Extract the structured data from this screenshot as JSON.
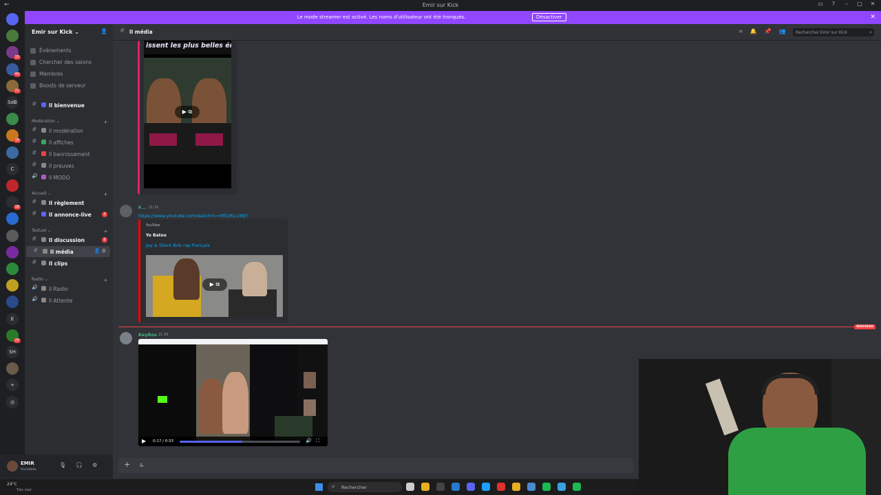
{
  "window": {
    "title": "Emir sur Kick"
  },
  "banner": {
    "message": "Le mode streamer est activé. Les noms d'utilisateur ont été tronqués.",
    "button": "Désactiver",
    "color": "#9146ff"
  },
  "servers": [
    {
      "label": "",
      "color": "#5865f2",
      "badge": ""
    },
    {
      "label": "",
      "color": "#4a7a3a",
      "badge": ""
    },
    {
      "label": "",
      "color": "#7a3a8a",
      "badge": "15"
    },
    {
      "label": "",
      "color": "#3a5aa0",
      "badge": "40"
    },
    {
      "label": "",
      "color": "#8a6a3a",
      "badge": "21"
    },
    {
      "label": "SdB",
      "color": "#2b2d31",
      "badge": ""
    },
    {
      "label": "",
      "color": "#3a8a4a",
      "badge": ""
    },
    {
      "label": "",
      "color": "#c8781e",
      "badge": "18"
    },
    {
      "label": "",
      "color": "#3a6aa0",
      "badge": ""
    },
    {
      "label": "C",
      "color": "#2b2d31",
      "badge": ""
    },
    {
      "label": "",
      "color": "#c0262b",
      "badge": ""
    },
    {
      "label": "",
      "color": "#2b2d31",
      "badge": "18"
    },
    {
      "label": "",
      "color": "#2a6ad0",
      "badge": ""
    },
    {
      "label": "",
      "color": "#5a5a5a",
      "badge": ""
    },
    {
      "label": "",
      "color": "#7a2aa0",
      "badge": ""
    },
    {
      "label": "",
      "color": "#2a8a3a",
      "badge": ""
    },
    {
      "label": "",
      "color": "#c0a020",
      "badge": ""
    },
    {
      "label": "",
      "color": "#2a4a8a",
      "badge": ""
    },
    {
      "label": "E",
      "color": "#2b2d31",
      "badge": ""
    },
    {
      "label": "",
      "color": "#2a7a2a",
      "badge": "29"
    },
    {
      "label": "SH",
      "color": "#2b2d31",
      "badge": ""
    },
    {
      "label": "",
      "color": "#6a5a4a",
      "badge": ""
    },
    {
      "label": "+",
      "color": "#2b2d31",
      "badge": ""
    },
    {
      "label": "◎",
      "color": "#2b2d31",
      "badge": ""
    }
  ],
  "guild": {
    "name": "Emir sur Kick"
  },
  "nav": [
    {
      "label": "Événements",
      "icon": "calendar-icon"
    },
    {
      "label": "Chercher des salons",
      "icon": "search-channels-icon"
    },
    {
      "label": "Membres",
      "icon": "members-icon"
    },
    {
      "label": "Boosts de serveur",
      "icon": "boost-icon"
    }
  ],
  "channels_top": [
    {
      "label": "ll bienvenue",
      "bold": true,
      "emoji_color": "#5865f2"
    }
  ],
  "categories": {
    "moderation": "Modération",
    "accueil": "Accueil",
    "textuel": "Textuel",
    "radio": "Radio"
  },
  "channels_mod": [
    {
      "label": "ll modération",
      "emoji_color": "#888"
    },
    {
      "label": "ll affiches",
      "emoji_color": "#3ba55d"
    },
    {
      "label": "ll bannissement",
      "emoji_color": "#ed4245"
    },
    {
      "label": "ll preuves",
      "emoji_color": "#888"
    },
    {
      "label": "ll MODO",
      "emoji_color": "#b05ac0"
    }
  ],
  "channels_accueil": [
    {
      "label": "ll règlement",
      "bold": true,
      "count": "",
      "emoji_color": "#888"
    },
    {
      "label": "ll annonce-live",
      "bold": true,
      "count": "3",
      "emoji_color": "#5865f2"
    }
  ],
  "channels_text": [
    {
      "label": "ll discussion",
      "bold": true,
      "count": "5",
      "emoji_color": "#888"
    },
    {
      "label": "ll média",
      "bold": true,
      "count": "",
      "emoji_color": "#888",
      "selected": true
    },
    {
      "label": "ll clips",
      "bold": true,
      "count": "",
      "emoji_color": "#888"
    }
  ],
  "channels_radio": [
    {
      "label": "ll Radio",
      "emoji_color": "#888"
    },
    {
      "label": "ll Attente",
      "emoji_color": "#888"
    }
  ],
  "user": {
    "name": "EMIR",
    "status": "Invisible"
  },
  "header": {
    "channel": "ll média",
    "search_placeholder": "Rechercher Emir sur Kick"
  },
  "embed1": {
    "caption": "issent les plus belles émotion"
  },
  "message1": {
    "author": "F...",
    "time": "21:31",
    "link": "https://www.youtube.com/watch?v=HfEzRLr2MJY",
    "provider": "YouTube",
    "embed_author": "Yo Batou",
    "embed_title": "Jay & Silent Bob rap français"
  },
  "new_marker": "NOUVEAU",
  "message2": {
    "author": "KeyRos",
    "time": "21:36",
    "video_time": "0:17 / 0:33",
    "progress": 0.52
  },
  "composer": {
    "placeholder": "&"
  },
  "taskbar": {
    "temp": "24°C",
    "weather": "Très clair",
    "search": "Rechercher",
    "app_colors": [
      "#ccc",
      "#e8b020",
      "#444",
      "#2a78d0",
      "#5865f2",
      "#1a9fff",
      "#e03030",
      "#e8b020",
      "#4a8ad0",
      "#1db954",
      "#3aa0e0",
      "#1db954"
    ]
  }
}
